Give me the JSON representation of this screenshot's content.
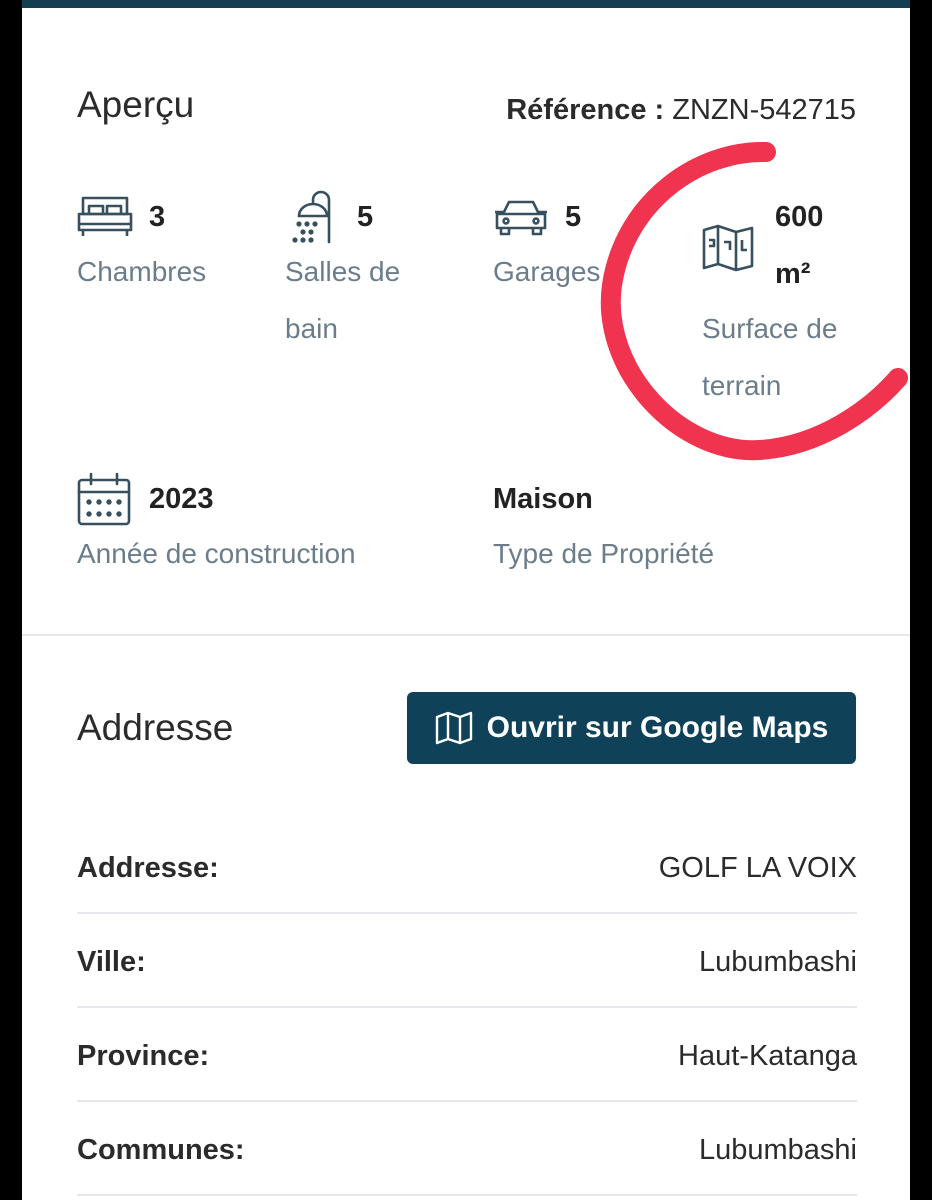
{
  "overview": {
    "title": "Aperçu",
    "reference_label": "Référence :",
    "reference_value": "ZNZN-542715",
    "features": [
      {
        "icon": "bed-icon",
        "value": "3",
        "label_lines": [
          "Chambres"
        ]
      },
      {
        "icon": "shower-icon",
        "value": "5",
        "label_lines": [
          "Salles de",
          "bain"
        ]
      },
      {
        "icon": "car-icon",
        "value": "5",
        "label_lines": [
          "Garages"
        ]
      },
      {
        "icon": "map-icon",
        "value_lines": [
          "600",
          "m²"
        ],
        "label_lines": [
          "Surface de",
          "terrain"
        ]
      },
      {
        "icon": "calendar-icon",
        "value": "2023",
        "label_lines": [
          "Année de construction"
        ]
      },
      {
        "icon": null,
        "value": "Maison",
        "label_lines": [
          "Type de Propriété"
        ]
      }
    ]
  },
  "address": {
    "title": "Addresse",
    "maps_button_label": "Ouvrir sur Google Maps",
    "rows": [
      {
        "label": "Addresse:",
        "value": "GOLF LA VOIX"
      },
      {
        "label": "Ville:",
        "value": "Lubumbashi"
      },
      {
        "label": "Province:",
        "value": "Haut-Katanga"
      },
      {
        "label": "Communes:",
        "value": "Lubumbashi"
      }
    ]
  },
  "colors": {
    "brand_dark": "#0f4258",
    "label_gray": "#6b7d8a",
    "annotation_red": "#f0334f"
  }
}
